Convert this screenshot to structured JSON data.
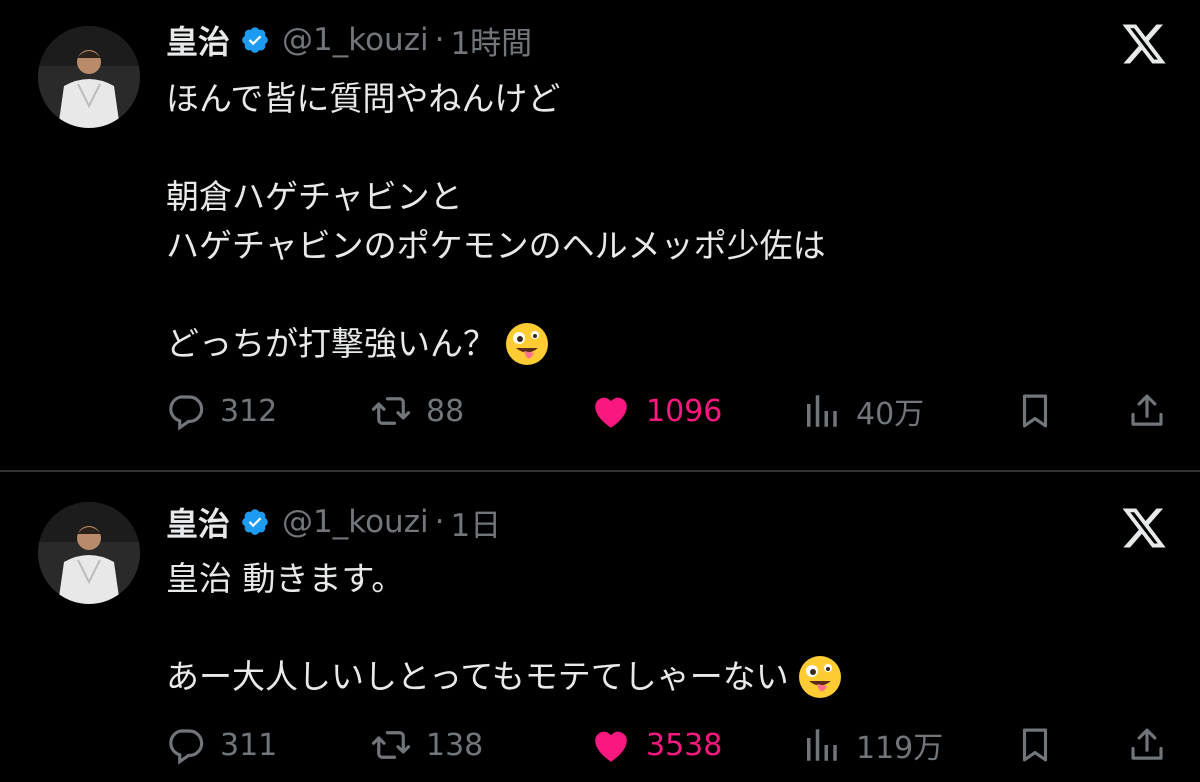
{
  "tweets": [
    {
      "author": {
        "display_name": "皇治",
        "handle": "@1_kouzi",
        "verified": true
      },
      "separator": "·",
      "time": "1時間",
      "lines": [
        "ほんで皆に質問やねんけど",
        "",
        "朝倉ハゲチャビンと",
        "ハゲチャビンのポケモンのヘルメッポ少佐は",
        "",
        "どっちが打撃強いん？"
      ],
      "trailing_emoji": "zany-face",
      "stats": {
        "replies": "312",
        "retweets": "88",
        "likes": "1096",
        "views": "40万"
      }
    },
    {
      "author": {
        "display_name": "皇治",
        "handle": "@1_kouzi",
        "verified": true
      },
      "separator": "·",
      "time": "1日",
      "lines": [
        "皇治 動きます。",
        "",
        "あー大人しいしとってもモテてしゃーない"
      ],
      "trailing_emoji": "zany-face",
      "stats": {
        "replies": "311",
        "retweets": "138",
        "likes": "3538",
        "views": "119万"
      }
    }
  ],
  "icons": {
    "verified": "verified-badge-icon",
    "platform": "x-logo-icon",
    "reply": "reply-icon",
    "retweet": "retweet-icon",
    "like": "heart-icon",
    "views": "views-icon",
    "bookmark": "bookmark-icon",
    "share": "share-icon"
  },
  "colors": {
    "background": "#000000",
    "text": "#e7e9ea",
    "muted": "#71767b",
    "verified": "#1d9bf0",
    "like": "#f91880",
    "divider": "#2f3336"
  }
}
